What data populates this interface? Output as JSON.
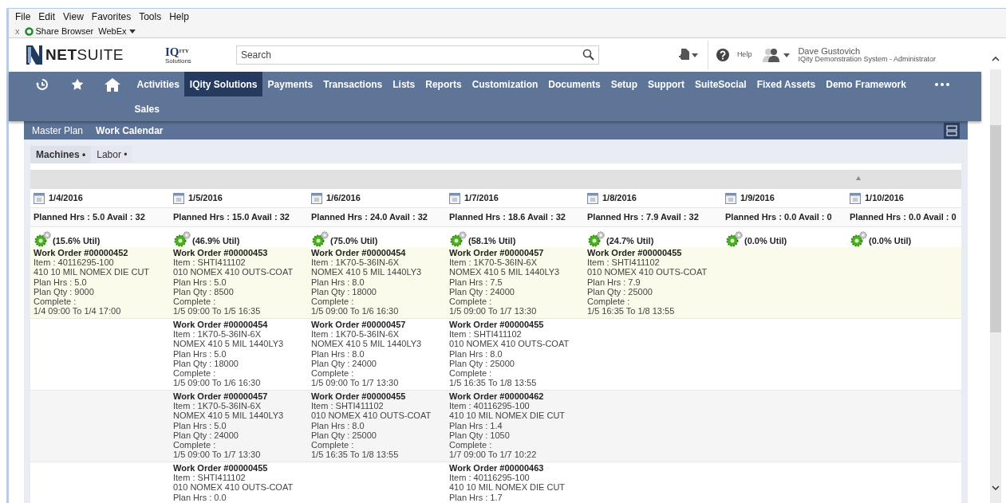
{
  "menu_bar": [
    "File",
    "Edit",
    "View",
    "Favorites",
    "Tools",
    "Help"
  ],
  "toolbar": {
    "close": "x",
    "items": [
      {
        "kind": "addon",
        "label": "Share Browser"
      },
      {
        "kind": "dropdown",
        "label": "WebEx"
      }
    ]
  },
  "header": {
    "logo": "**NET**SUITE",
    "partner_logo": {
      "main": "IQ",
      "sup": "ITY",
      "sub": "Solutions"
    },
    "search": {
      "placeholder": "Search"
    },
    "help": "Help",
    "user": {
      "name": "Dave Gustovich",
      "role": "IQity Demonstration System - Administrator"
    }
  },
  "nav": {
    "items": [
      {
        "label": "Activities",
        "selected": false
      },
      {
        "label": "IQity Solutions",
        "selected": true
      },
      {
        "label": "Payments",
        "selected": false
      },
      {
        "label": "Transactions",
        "selected": false
      },
      {
        "label": "Lists",
        "selected": false
      },
      {
        "label": "Reports",
        "selected": false
      },
      {
        "label": "Customization",
        "selected": false
      },
      {
        "label": "Documents",
        "selected": false
      },
      {
        "label": "Setup",
        "selected": false
      },
      {
        "label": "Support",
        "selected": false
      },
      {
        "label": "SuiteSocial",
        "selected": false
      },
      {
        "label": "Fixed Assets",
        "selected": false
      },
      {
        "label": "Demo Framework",
        "selected": false
      },
      {
        "label": "Sales",
        "selected": false
      }
    ]
  },
  "subtabs": [
    {
      "label": "Master Plan",
      "selected": false
    },
    {
      "label": "Work Calendar",
      "selected": true
    }
  ],
  "tabs": [
    {
      "label": "Machines •",
      "selected": true
    },
    {
      "label": "Labor •",
      "selected": false
    }
  ],
  "days": [
    {
      "date": "1/4/2016",
      "planned": "Planned Hrs : 5.0 Avail : 32",
      "util": "(15.6% Util)"
    },
    {
      "date": "1/5/2016",
      "planned": "Planned Hrs : 15.0 Avail : 32",
      "util": "(46.9% Util)"
    },
    {
      "date": "1/6/2016",
      "planned": "Planned Hrs : 24.0 Avail : 32",
      "util": "(75.0% Util)"
    },
    {
      "date": "1/7/2016",
      "planned": "Planned Hrs : 18.6 Avail : 32",
      "util": "(58.1% Util)"
    },
    {
      "date": "1/8/2016",
      "planned": "Planned Hrs : 7.9 Avail : 32",
      "util": "(24.7% Util)"
    },
    {
      "date": "1/9/2016",
      "planned": "Planned Hrs : 0.0 Avail : 0",
      "util": "(0.0% Util)"
    },
    {
      "date": "1/10/2016",
      "planned": "Planned Hrs : 0.0 Avail : 0",
      "util": "(0.0% Util)"
    }
  ],
  "rows": [
    {
      "kind": "highlight",
      "cells": [
        {
          "kind": "order",
          "title": "Work Order #00000452",
          "lines": [
            "Item : 40116295-100",
            "410 10 MIL NOMEX DIE CUT",
            "Plan Hrs : 5.0",
            "Plan Qty : 9000",
            "Complete :",
            "1/4 09:00 To 1/4 17:00"
          ]
        },
        {
          "kind": "order",
          "title": "Work Order #00000453",
          "lines": [
            "Item : SHTI411102",
            "010 NOMEX 410 OUTS-COAT",
            "Plan Hrs : 5.0",
            "Plan Qty : 8500",
            "Complete :",
            "1/5 09:00 To 1/5 16:35"
          ]
        },
        {
          "kind": "order",
          "title": "Work Order #00000454",
          "lines": [
            "Item : 1K70-5-36IN-6X",
            "NOMEX 410 5 MIL 1440LY3",
            "Plan Hrs : 8.0",
            "Plan Qty : 18000",
            "Complete :",
            "1/5 09:00 To 1/6 16:30"
          ]
        },
        {
          "kind": "order",
          "title": "Work Order #00000457",
          "lines": [
            "Item : 1K70-5-36IN-6X",
            "NOMEX 410 5 MIL 1440LY3",
            "Plan Hrs : 7.5",
            "Plan Qty : 24000",
            "Complete :",
            "1/5 09:00 To 1/7 13:30"
          ]
        },
        {
          "kind": "order",
          "title": "Work Order #00000455",
          "lines": [
            "Item : SHTI411102",
            "010 NOMEX 410 OUTS-COAT",
            "Plan Hrs : 7.9",
            "Plan Qty : 25000",
            "Complete :",
            "1/5 16:35 To 1/8 13:55"
          ]
        },
        {
          "kind": "empty"
        },
        {
          "kind": "empty"
        }
      ]
    },
    {
      "kind": "plain",
      "cells": [
        {
          "kind": "empty"
        },
        {
          "kind": "order",
          "title": "Work Order #00000454",
          "lines": [
            "Item : 1K70-5-36IN-6X",
            "NOMEX 410 5 MIL 1440LY3",
            "Plan Hrs : 5.0",
            "Plan Qty : 18000",
            "Complete :",
            "1/5 09:00 To 1/6 16:30"
          ]
        },
        {
          "kind": "order",
          "title": "Work Order #00000457",
          "lines": [
            "Item : 1K70-5-36IN-6X",
            "NOMEX 410 5 MIL 1440LY3",
            "Plan Hrs : 8.0",
            "Plan Qty : 24000",
            "Complete :",
            "1/5 09:00 To 1/7 13:30"
          ]
        },
        {
          "kind": "order",
          "title": "Work Order #00000455",
          "lines": [
            "Item : SHTI411102",
            "010 NOMEX 410 OUTS-COAT",
            "Plan Hrs : 8.0",
            "Plan Qty : 25000",
            "Complete :",
            "1/5 16:35 To 1/8 13:55"
          ]
        },
        {
          "kind": "empty"
        },
        {
          "kind": "empty"
        },
        {
          "kind": "empty"
        }
      ]
    },
    {
      "kind": "shaded",
      "cells": [
        {
          "kind": "empty"
        },
        {
          "kind": "order",
          "title": "Work Order #00000457",
          "lines": [
            "Item : 1K70-5-36IN-6X",
            "NOMEX 410 5 MIL 1440LY3",
            "Plan Hrs : 5.0",
            "Plan Qty : 24000",
            "Complete :",
            "1/5 09:00 To 1/7 13:30"
          ]
        },
        {
          "kind": "order",
          "title": "Work Order #00000455",
          "lines": [
            "Item : SHTI411102",
            "010 NOMEX 410 OUTS-COAT",
            "Plan Hrs : 8.0",
            "Plan Qty : 25000",
            "Complete :",
            "1/5 16:35 To 1/8 13:55"
          ]
        },
        {
          "kind": "order",
          "title": "Work Order #00000462",
          "lines": [
            "Item : 40116295-100",
            "410 10 MIL NOMEX DIE CUT",
            "Plan Hrs : 1.4",
            "Plan Qty : 1050",
            "Complete :",
            "1/7 09:00 To 1/7 10:22"
          ]
        },
        {
          "kind": "empty"
        },
        {
          "kind": "empty"
        },
        {
          "kind": "empty"
        }
      ]
    },
    {
      "kind": "plain",
      "cells": [
        {
          "kind": "empty"
        },
        {
          "kind": "order",
          "title": "Work Order #00000455",
          "lines": [
            "Item : SHTI411102",
            "010 NOMEX 410 OUTS-COAT",
            "Plan Hrs : 0.0"
          ]
        },
        {
          "kind": "empty"
        },
        {
          "kind": "order",
          "title": "Work Order #00000463",
          "lines": [
            "Item : 40116295-100",
            "410 10 MIL NOMEX DIE CUT",
            "Plan Hrs : 1.7"
          ]
        },
        {
          "kind": "empty"
        },
        {
          "kind": "empty"
        },
        {
          "kind": "empty"
        }
      ]
    }
  ]
}
